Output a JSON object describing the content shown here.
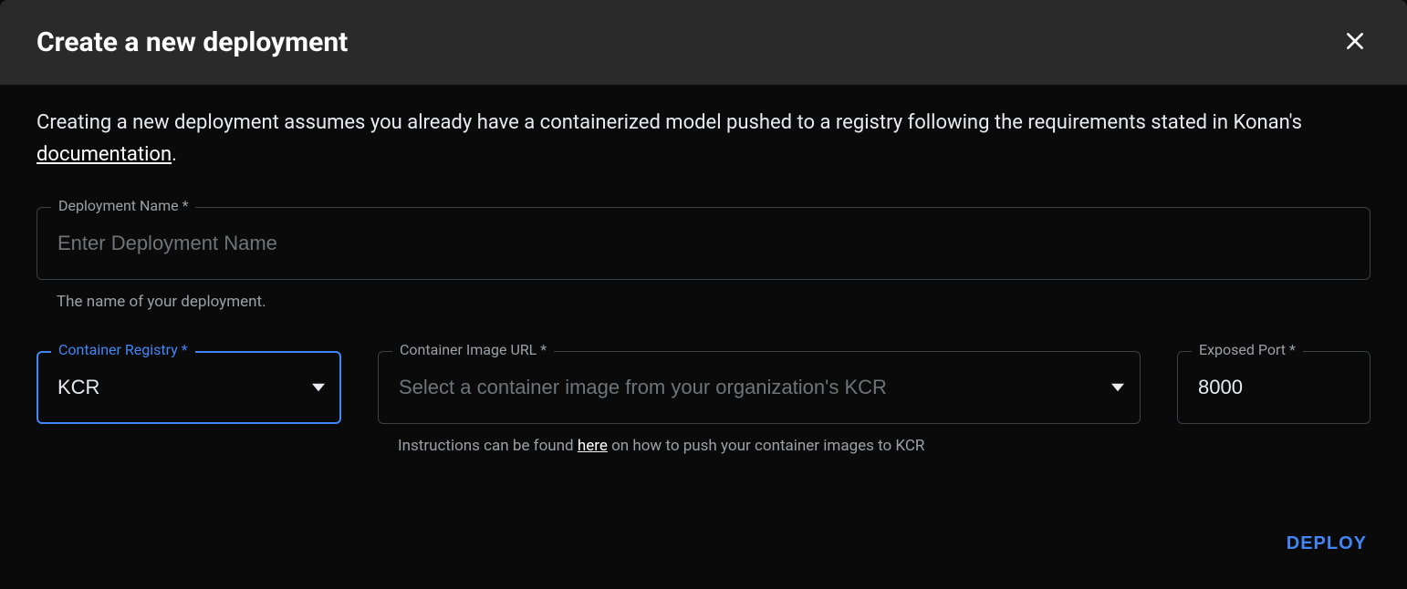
{
  "header": {
    "title": "Create a new deployment"
  },
  "description": {
    "prefix": "Creating a new deployment assumes you already have a containerized model pushed to a registry following the requirements stated in Konan's ",
    "link": "documentation",
    "suffix": "."
  },
  "fields": {
    "deploymentName": {
      "label": "Deployment Name *",
      "placeholder": "Enter Deployment Name",
      "helper": "The name of your deployment."
    },
    "containerRegistry": {
      "label": "Container Registry *",
      "value": "KCR"
    },
    "containerImage": {
      "label": "Container Image URL *",
      "placeholder": "Select a container image from your organization's KCR",
      "helperPrefix": "Instructions can be found ",
      "helperLink": "here",
      "helperSuffix": " on how to push your container images to KCR"
    },
    "exposedPort": {
      "label": "Exposed Port *",
      "value": "8000"
    }
  },
  "actions": {
    "deploy": "DEPLOY"
  }
}
